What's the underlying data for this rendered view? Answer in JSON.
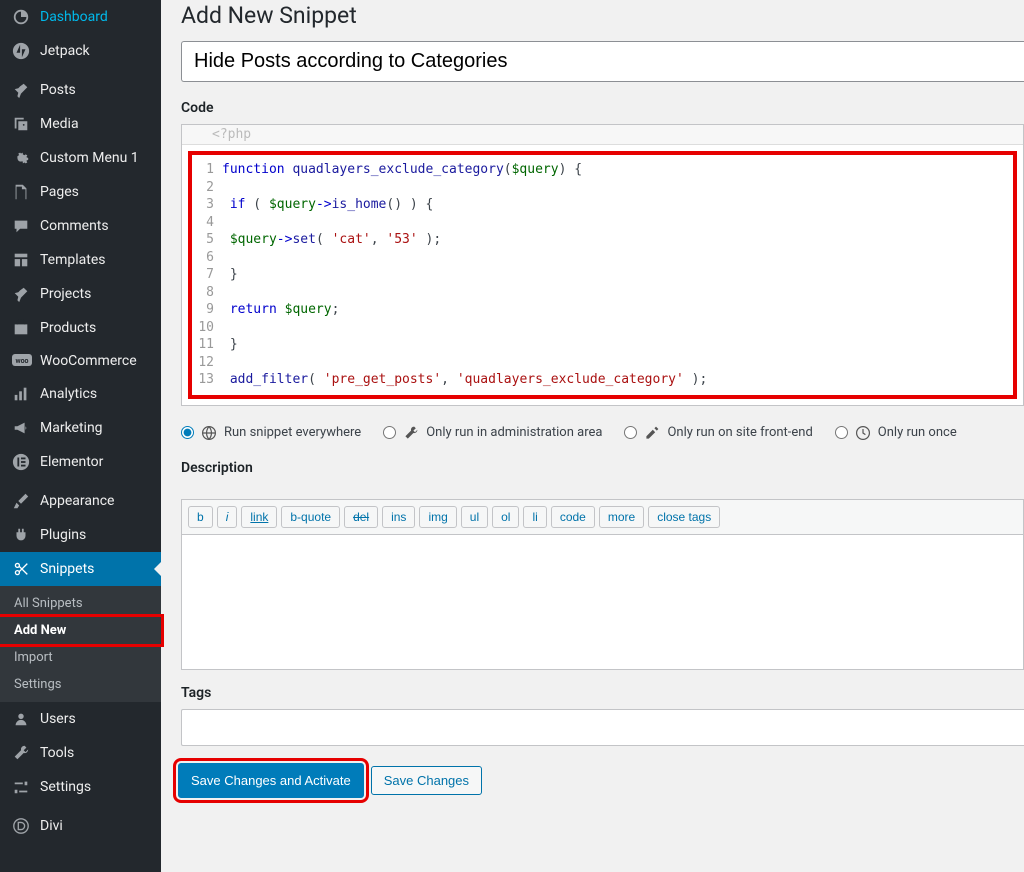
{
  "sidebar": {
    "items": [
      {
        "label": "Dashboard",
        "icon": "dashboard"
      },
      {
        "label": "Jetpack",
        "icon": "jetpack"
      },
      {
        "label": "Posts",
        "icon": "pin"
      },
      {
        "label": "Media",
        "icon": "media"
      },
      {
        "label": "Custom Menu 1",
        "icon": "gear"
      },
      {
        "label": "Pages",
        "icon": "page"
      },
      {
        "label": "Comments",
        "icon": "comment"
      },
      {
        "label": "Templates",
        "icon": "templates"
      },
      {
        "label": "Projects",
        "icon": "pin"
      },
      {
        "label": "Products",
        "icon": "products"
      },
      {
        "label": "WooCommerce",
        "icon": "woo"
      },
      {
        "label": "Analytics",
        "icon": "bars"
      },
      {
        "label": "Marketing",
        "icon": "megaphone"
      },
      {
        "label": "Elementor",
        "icon": "elementor"
      },
      {
        "label": "Appearance",
        "icon": "brush"
      },
      {
        "label": "Plugins",
        "icon": "plug"
      },
      {
        "label": "Snippets",
        "icon": "scissors",
        "active": true
      },
      {
        "label": "Users",
        "icon": "user"
      },
      {
        "label": "Tools",
        "icon": "wrench"
      },
      {
        "label": "Settings",
        "icon": "sliders"
      },
      {
        "label": "Divi",
        "icon": "divi"
      }
    ],
    "submenu": [
      {
        "label": "All Snippets"
      },
      {
        "label": "Add New",
        "current": true,
        "highlight": true
      },
      {
        "label": "Import"
      },
      {
        "label": "Settings"
      }
    ]
  },
  "page": {
    "title": "Add New Snippet",
    "snippet_title": "Hide Posts according to Categories",
    "code_section_label": "Code",
    "php_hint": "<?php",
    "code_lines": [
      "function quadlayers_exclude_category($query) {",
      "",
      " if ( $query->is_home() ) {",
      "",
      " $query->set( 'cat', '53' );",
      "",
      " }",
      "",
      " return $query;",
      "",
      " }",
      "",
      " add_filter( 'pre_get_posts', 'quadlayers_exclude_category' );"
    ],
    "scope": {
      "everywhere": "Run snippet everywhere",
      "admin": "Only run in administration area",
      "frontend": "Only run on site front-end",
      "once": "Only run once",
      "selected": "everywhere"
    },
    "description_label": "Description",
    "quicktags": [
      "b",
      "i",
      "link",
      "b-quote",
      "del",
      "ins",
      "img",
      "ul",
      "ol",
      "li",
      "code",
      "more",
      "close tags"
    ],
    "tags_label": "Tags",
    "buttons": {
      "save_activate": "Save Changes and Activate",
      "save": "Save Changes"
    }
  }
}
